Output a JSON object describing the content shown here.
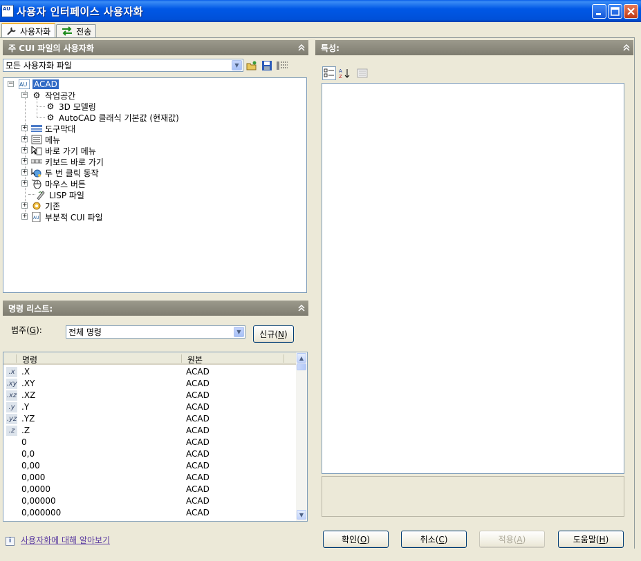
{
  "window": {
    "title": "사용자 인터페이스 사용자화",
    "icon_text": "AU"
  },
  "tabs": [
    {
      "label": "사용자화",
      "icon": "wrench-icon",
      "active": true
    },
    {
      "label": "전송",
      "icon": "transfer-arrows-icon",
      "active": false
    }
  ],
  "left_panel": {
    "header": "주 CUI 파일의 사용자화",
    "file_filter": "모든 사용자화 파일"
  },
  "tree": {
    "root": "ACAD",
    "items": [
      {
        "label": "작업공간",
        "icon": "gear-icon"
      },
      {
        "label": "3D 모델링",
        "icon": "gear-icon"
      },
      {
        "label": "AutoCAD 클래식 기본값 (현재값)",
        "icon": "gear-icon"
      },
      {
        "label": "도구막대",
        "icon": "toolbar-icon"
      },
      {
        "label": "메뉴",
        "icon": "menu-icon"
      },
      {
        "label": "바로 가기 메뉴",
        "icon": "shortcut-menu-icon"
      },
      {
        "label": "키보드 바로 가기",
        "icon": "keyboard-icon"
      },
      {
        "label": "두 번 클릭 동작",
        "icon": "double-click-icon"
      },
      {
        "label": "마우스 버튼",
        "icon": "mouse-icon"
      },
      {
        "label": "LISP 파일",
        "icon": "lisp-icon"
      },
      {
        "label": "기존",
        "icon": "legacy-icon"
      },
      {
        "label": "부분적 CUI 파일",
        "icon": "partial-cui-icon"
      }
    ]
  },
  "properties": {
    "header": "특성:"
  },
  "command_list": {
    "header": "명령 리스트:",
    "category_label": "범주(",
    "category_mnemonic": "G",
    "category_suffix": "):",
    "category_value": "전체 명령",
    "new_button": "신규(",
    "new_mnemonic": "N",
    "new_suffix": ")",
    "columns": [
      "명령",
      "원본"
    ],
    "rows": [
      {
        "icon": ".x",
        "name": ".X",
        "source": "ACAD"
      },
      {
        "icon": ".xy",
        "name": ".XY",
        "source": "ACAD"
      },
      {
        "icon": ".xz",
        "name": ".XZ",
        "source": "ACAD"
      },
      {
        "icon": ".y",
        "name": ".Y",
        "source": "ACAD"
      },
      {
        "icon": ".yz",
        "name": ".YZ",
        "source": "ACAD"
      },
      {
        "icon": ".z",
        "name": ".Z",
        "source": "ACAD"
      },
      {
        "icon": "",
        "name": "0",
        "source": "ACAD"
      },
      {
        "icon": "",
        "name": "0,0",
        "source": "ACAD"
      },
      {
        "icon": "",
        "name": "0,00",
        "source": "ACAD"
      },
      {
        "icon": "",
        "name": "0,000",
        "source": "ACAD"
      },
      {
        "icon": "",
        "name": "0,0000",
        "source": "ACAD"
      },
      {
        "icon": "",
        "name": "0,00000",
        "source": "ACAD"
      },
      {
        "icon": "",
        "name": "0,000000",
        "source": "ACAD"
      }
    ]
  },
  "footer": {
    "link": "사용자화에 대해 알아보기",
    "ok": "확인(",
    "ok_mn": "O",
    "ok_sfx": ")",
    "cancel": "취소(",
    "cancel_mn": "C",
    "cancel_sfx": ")",
    "apply": "적용(",
    "apply_mn": "A",
    "apply_sfx": ")",
    "help": "도움말(",
    "help_mn": "H",
    "help_sfx": ")"
  }
}
